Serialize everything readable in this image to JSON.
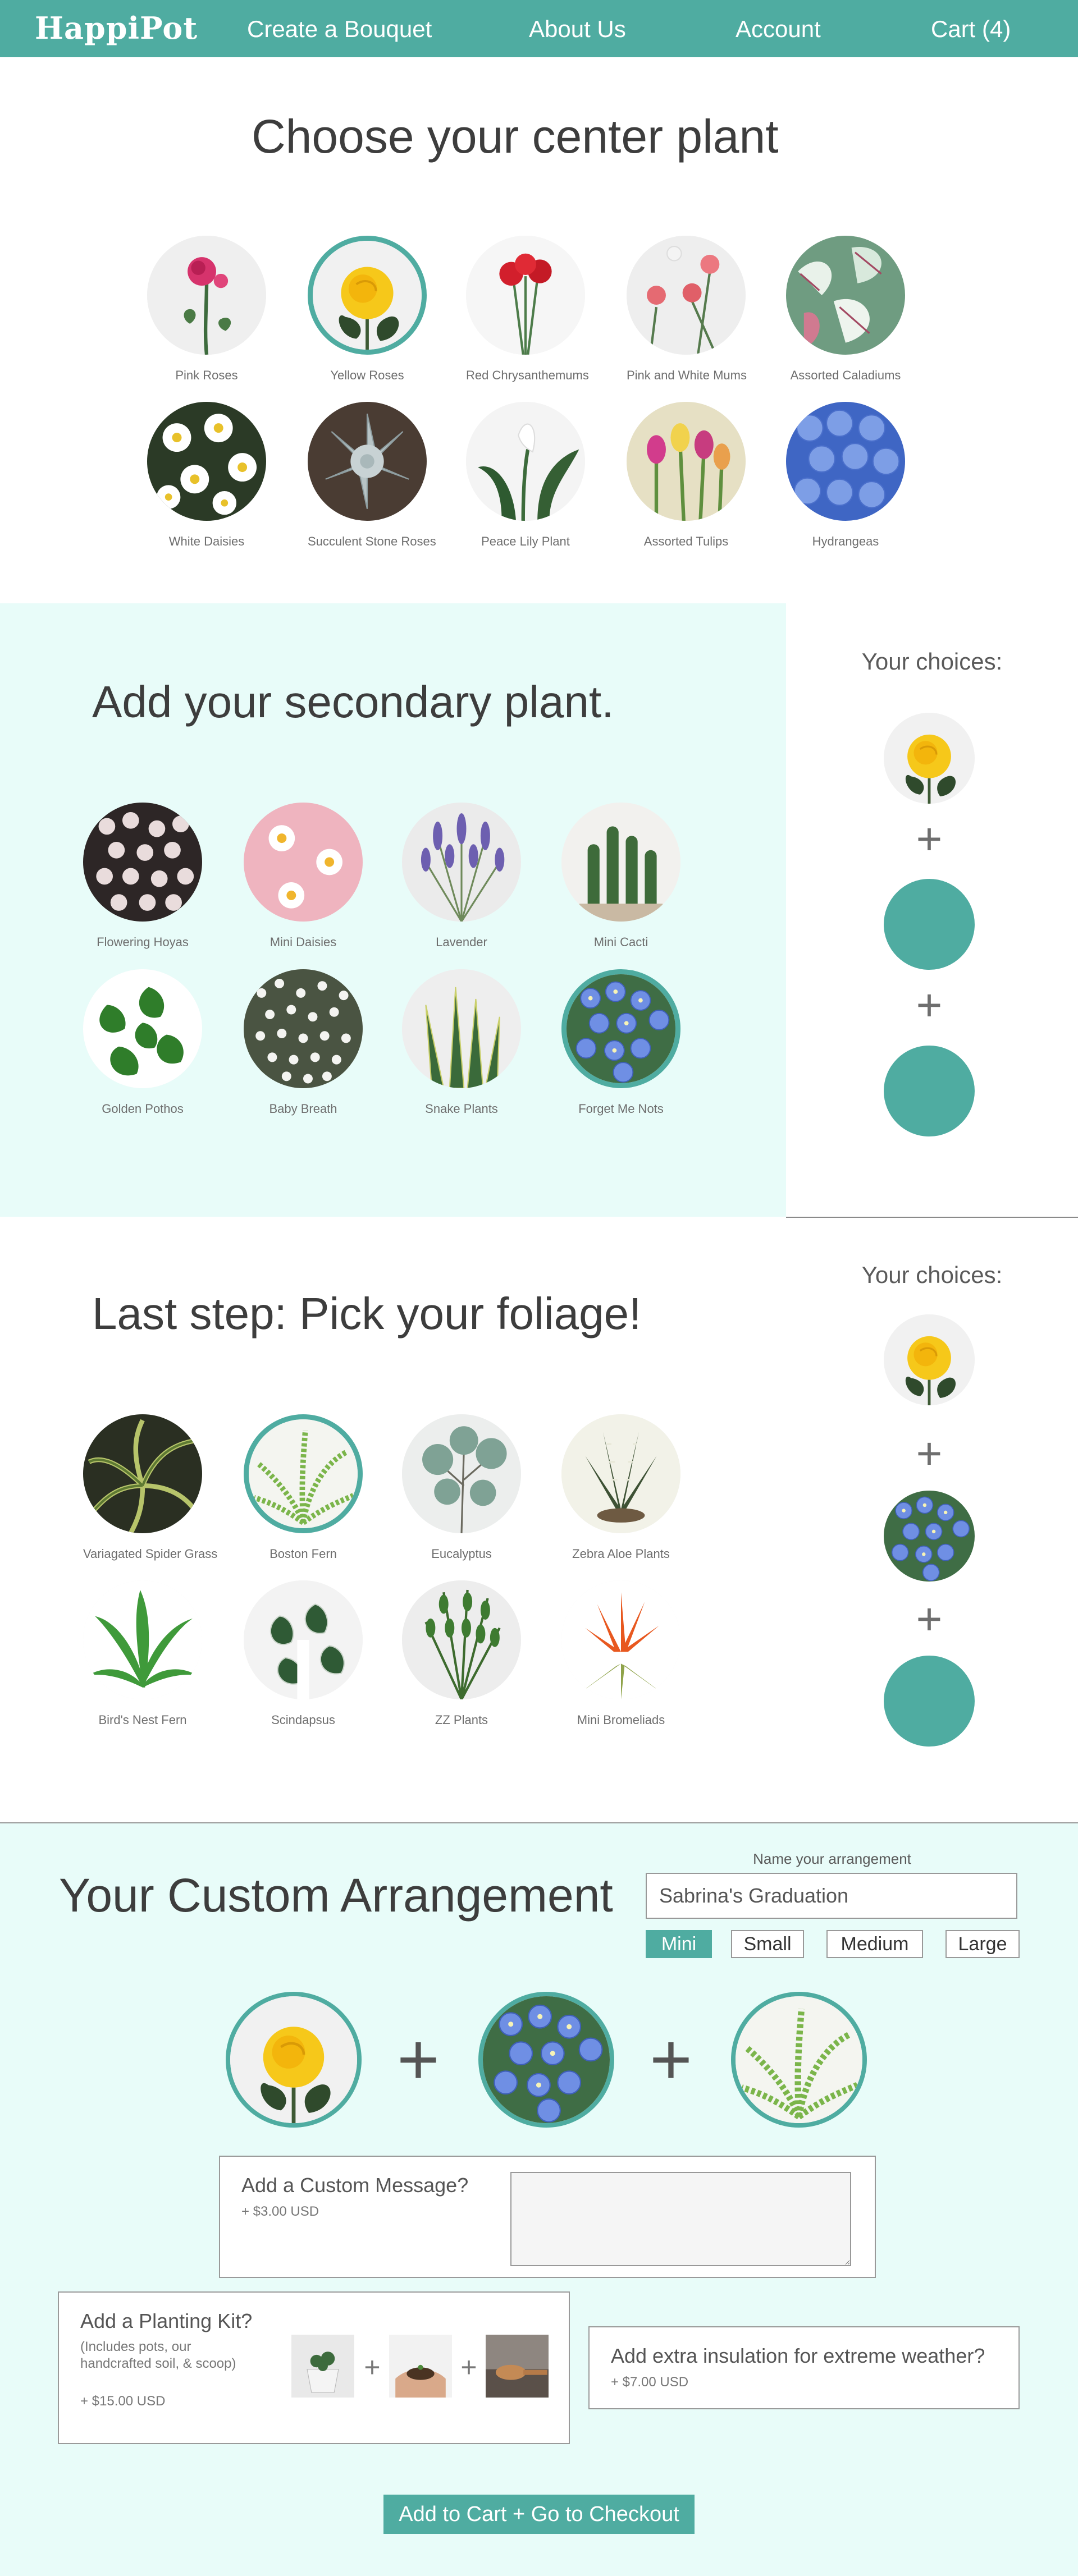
{
  "nav": {
    "logo": "HappiPot",
    "links": [
      "Create a Bouquet",
      "About Us",
      "Account",
      "Cart (4)"
    ]
  },
  "center": {
    "title": "Choose your center plant",
    "plants": [
      "Pink Roses",
      "Yellow Roses",
      "Red Chrysanthemums",
      "Pink and White Mums",
      "Assorted Caladiums",
      "White Daisies",
      "Succulent Stone Roses",
      "Peace Lily Plant",
      "Assorted Tulips",
      "Hydrangeas"
    ],
    "selected": "Yellow Roses"
  },
  "secondary": {
    "title": "Add your secondary plant.",
    "plants": [
      "Flowering Hoyas",
      "Mini Daisies",
      "Lavender",
      "Mini Cacti",
      "Golden Pothos",
      "Baby Breath",
      "Snake Plants",
      "Forget Me Nots"
    ],
    "selected": "Forget Me Nots",
    "choices_title": "Your choices:",
    "plus": "+"
  },
  "foliage": {
    "title": "Last step: Pick your foliage!",
    "plants": [
      "Variagated Spider Grass",
      "Boston Fern",
      "Eucalyptus",
      "Zebra Aloe Plants",
      "Bird's Nest Fern",
      "Scindapsus",
      "ZZ Plants",
      "Mini Bromeliads"
    ],
    "selected": "Boston Fern",
    "choices_title": "Your choices:",
    "plus": "+"
  },
  "arrangement": {
    "title": "Your Custom Arrangement",
    "name_label": "Name your arrangement",
    "name_value": "Sabrina's Graduation",
    "sizes": [
      "Mini",
      "Small",
      "Medium",
      "Large"
    ],
    "selected_size": "Mini",
    "plus": "+",
    "message": {
      "title": "Add a Custom Message?",
      "price": "+ $3.00 USD"
    },
    "kit": {
      "title": "Add a Planting Kit?",
      "subtitle": "(Includes pots, our handcrafted soil, & scoop)",
      "price": "+ $15.00 USD",
      "plus": "+"
    },
    "insulation": {
      "title": "Add extra insulation for extreme weather?",
      "price": "+ $7.00 USD"
    },
    "checkout": "Add to Cart + Go to Checkout"
  },
  "colors": {
    "accent": "#4faca1",
    "mint_bg": "#e8fcf9"
  }
}
